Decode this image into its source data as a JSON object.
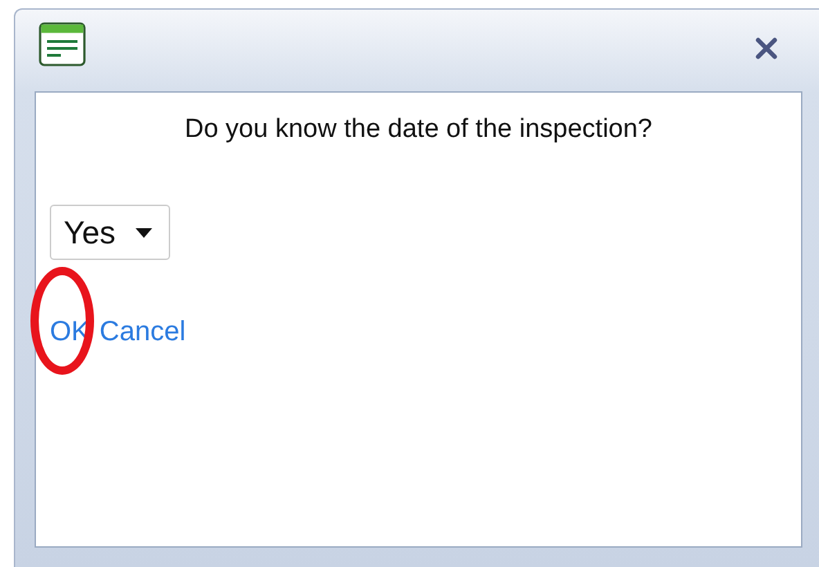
{
  "dialog": {
    "question": "Do you know the date of the inspection?",
    "answer": {
      "value": "Yes"
    },
    "links": [
      {
        "label": "OK",
        "circled": true
      },
      {
        "label": "Cancel",
        "circled": false
      }
    ]
  }
}
